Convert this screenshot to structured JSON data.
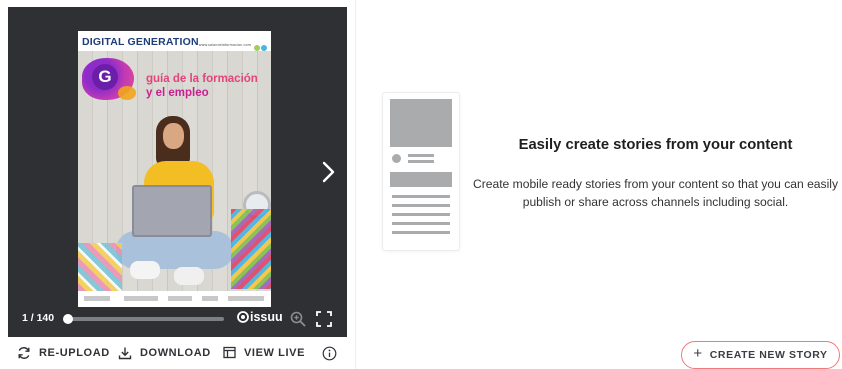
{
  "viewer": {
    "cover": {
      "title": "DIGITAL GENERATION",
      "url": "www.salondelaformacion.com",
      "badge_letter": "G",
      "subtitle_line1": "guía de la formación",
      "subtitle_line2": "y el empleo",
      "dot_colors": [
        "#9ccf5b",
        "#4ab6d9"
      ]
    },
    "page_indicator": "1 / 140",
    "progress": 0.01,
    "brand": "issuu",
    "icons": {
      "next": "chevron-right-icon",
      "zoom": "zoom-in-icon",
      "fullscreen": "fullscreen-icon"
    }
  },
  "actions": {
    "reupload": "RE-UPLOAD",
    "download": "DOWNLOAD",
    "view_live": "VIEW LIVE",
    "info_icon": "info-icon"
  },
  "stories": {
    "title": "Easily create stories from your content",
    "description": "Create mobile ready stories from your content so that you can easily publish or share across channels including social.",
    "create_button": "CREATE NEW STORY",
    "create_button_icon": "+",
    "accent_color": "#ef7b7b"
  }
}
